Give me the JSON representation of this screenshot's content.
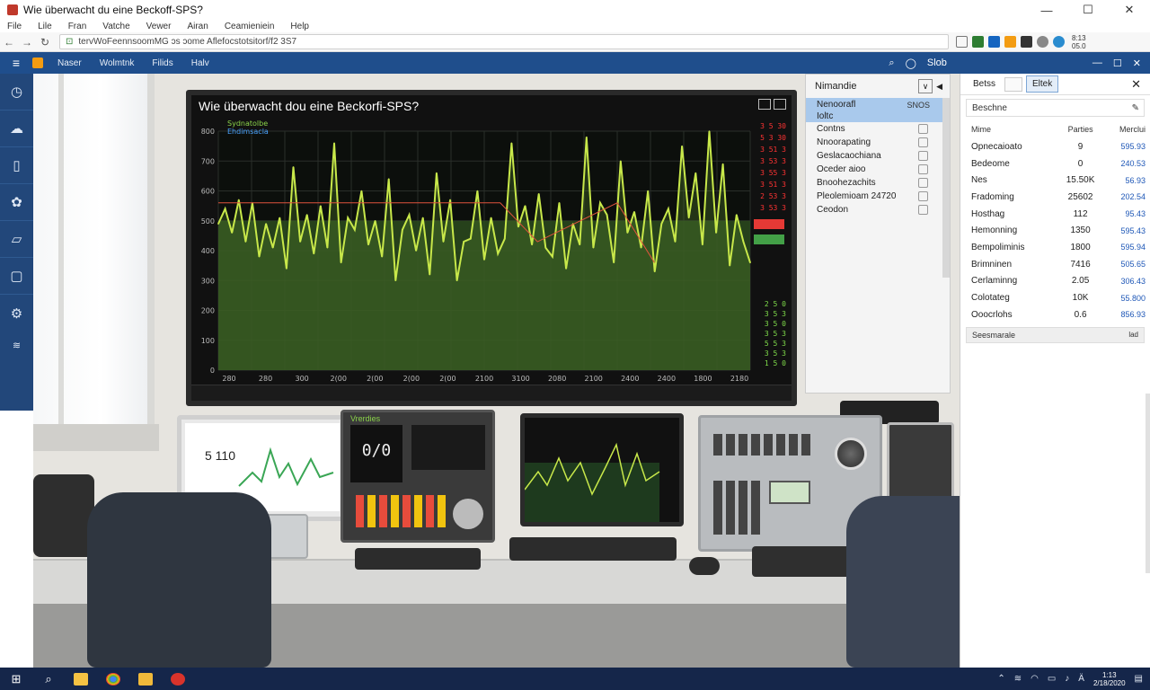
{
  "window": {
    "title": "Wie überwacht du eine Beckoff-SPS?",
    "controls": [
      "—",
      "☐",
      "✕"
    ]
  },
  "menu": [
    "File",
    "Lile",
    "Fran",
    "Vatche",
    "Vewer",
    "Airan",
    "Ceamieniein",
    "Help"
  ],
  "address": {
    "url": "tervWoFeennsoomMG ɔs ɔome Aflefocstotsitorf/f2 3S7",
    "clock_top": "8:13",
    "clock_bottom": "05.0"
  },
  "app_toolbar": {
    "items": [
      "Naser",
      "Wolmtnk",
      "Filids",
      "Halv"
    ],
    "right_label": "Slob"
  },
  "monitor": {
    "title": "Wie überwacht dou eine Beckorfi-SPS?",
    "legend": [
      "Sydnatolbe",
      "Ehdimsacla"
    ]
  },
  "chart_data": {
    "type": "line",
    "title": "Wie überwacht dou eine Beckorfi-SPS?",
    "y_ticks": [
      800,
      700,
      600,
      500,
      400,
      300,
      200,
      100,
      0
    ],
    "x_ticks": [
      "280",
      "280",
      "300",
      "2(00",
      "2(00",
      "2(00",
      "2(00",
      "2100",
      "3100",
      "2080",
      "2100",
      "2400",
      "2400",
      "1800",
      "2180"
    ],
    "ylim": [
      0,
      800
    ],
    "series": [
      {
        "values": [
          490,
          540,
          460,
          570,
          430,
          560,
          380,
          490,
          410,
          510,
          340,
          680,
          430,
          520,
          390,
          550,
          410,
          760,
          360,
          510,
          470,
          600,
          420,
          500,
          380,
          640,
          300,
          470,
          520,
          400,
          510,
          320,
          660,
          430,
          570,
          300,
          430,
          440,
          600,
          370,
          510,
          390,
          440,
          760,
          480,
          550,
          420,
          590,
          410,
          380,
          560,
          340,
          490,
          420,
          780,
          410,
          560,
          520,
          360,
          700,
          460,
          530,
          410,
          600,
          330,
          490,
          540,
          430,
          750,
          510,
          660,
          420,
          800,
          460,
          690,
          350,
          520,
          430,
          360
        ],
        "color": "#c8e84a"
      }
    ],
    "reference_line": {
      "value": 560,
      "color": "#e0533d"
    },
    "band_level": 500,
    "grid": true
  },
  "side_indicators": [
    "3 5 30",
    "5 3 30",
    "3 51 3",
    "3 53 3",
    "3 55 3",
    "3 51 3",
    "2 53 3",
    "3 53 3"
  ],
  "side_values": [
    "2 5 0",
    "3 5 3",
    "3 5 0",
    "3 5 3",
    "5 5 3",
    "3 5 3",
    "1 5 0"
  ],
  "laptop": {
    "big_value": "5 110"
  },
  "console1": {
    "display": "0/0",
    "label": "Vrerdies"
  },
  "list_panel": {
    "header": "Nimandie",
    "selected_label": "Nenoorafl",
    "selected_value": "SNOS",
    "selected_sub": "Ioltc",
    "rows": [
      {
        "label": "Contns"
      },
      {
        "label": "Nnoorapating"
      },
      {
        "label": "Geslacaochiana"
      },
      {
        "label": "Oceder aioo"
      },
      {
        "label": "Bnoohezachits"
      },
      {
        "label": "Pleolemioam 24720"
      },
      {
        "label": "Ceodon"
      }
    ]
  },
  "props_panel": {
    "tabs": [
      "Betss",
      "",
      "Eltek"
    ],
    "search_label": "Beschne",
    "columns": [
      "Mime",
      "Parties",
      "Merclui"
    ],
    "rows": [
      {
        "name": "Opnecaioato",
        "parties": "9",
        "value": "595.93"
      },
      {
        "name": "Bedeome",
        "parties": "0",
        "value": "240.53"
      },
      {
        "name": "Nes",
        "parties": "15.50K",
        "value": "56.93"
      },
      {
        "name": "Fradoming",
        "parties": "25602",
        "value": "202.54"
      },
      {
        "name": "Hosthag",
        "parties": "112",
        "value": "95.43"
      },
      {
        "name": "Hemonning",
        "parties": "1350",
        "value": "595.43"
      },
      {
        "name": "Bempoliminis",
        "parties": "1800",
        "value": "595.94"
      },
      {
        "name": "Brimninen",
        "parties": "7416",
        "value": "505.65"
      },
      {
        "name": "Cerlaminng",
        "parties": "2.05",
        "value": "306.43"
      },
      {
        "name": "Colotateg",
        "parties": "10K",
        "value": "55.800"
      },
      {
        "name": "Ooocrlohs",
        "parties": "0.6",
        "value": "856.93"
      }
    ],
    "footer_label": "Seesmarale",
    "footer_right": "lad"
  },
  "taskbar": {
    "time": "1:13",
    "date": "2/18/2020"
  }
}
